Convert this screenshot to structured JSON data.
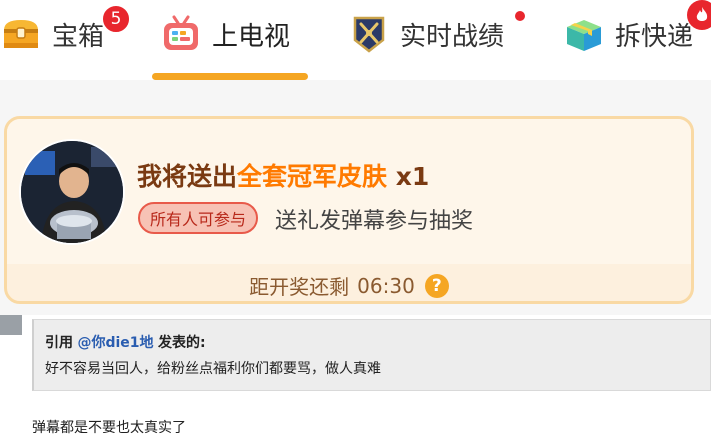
{
  "tabs": [
    {
      "label": "宝箱",
      "icon": "treasure-chest-icon",
      "badge": "5"
    },
    {
      "label": "上电视",
      "icon": "tv-icon",
      "active": true
    },
    {
      "label": "实时战绩",
      "icon": "battle-record-icon",
      "dot": true
    },
    {
      "label": "拆快递",
      "icon": "package-icon",
      "badge_icon": "fire-icon"
    }
  ],
  "lottery": {
    "prize_prefix": "我将送出",
    "prize_highlight": "全套冠军皮肤",
    "prize_count": "x1",
    "eligibility": "所有人可参与",
    "rule": "送礼发弹幕参与抽奖",
    "countdown_label": "距开奖还剩",
    "countdown_time": "06:30",
    "help_symbol": "?"
  },
  "post": {
    "quote_prefix": "引用",
    "quote_user": "@你die1地",
    "quote_suffix": "发表的:",
    "quote_text": "好不容易当回人，给粉丝点福利你们都要骂，做人真难",
    "reply_text": "弹幕都是不要也太真实了"
  },
  "colors": {
    "accent": "#f5a623",
    "badge": "#e8262d",
    "prize": "#ff7a00",
    "card_bg": "#fdf0de"
  }
}
